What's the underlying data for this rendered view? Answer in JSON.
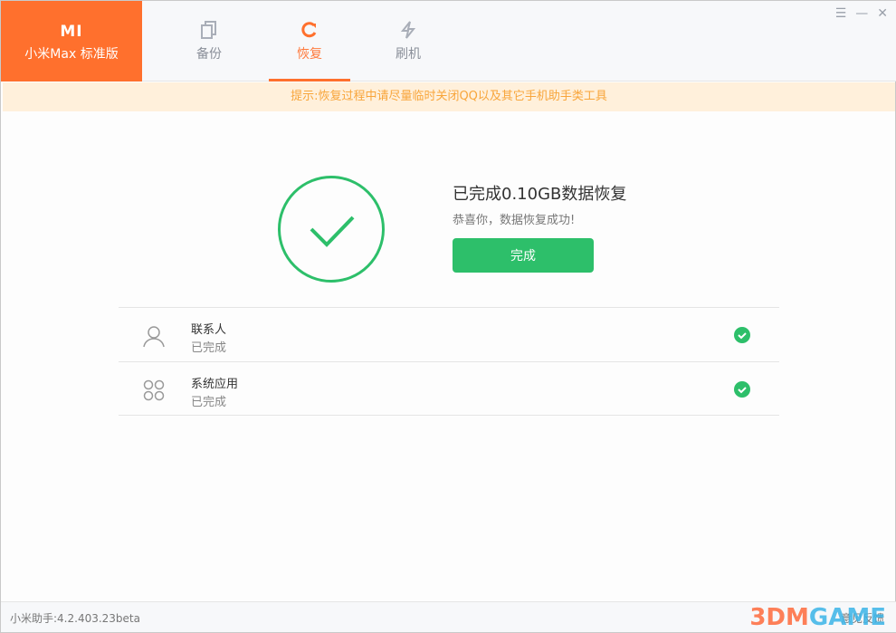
{
  "brand": {
    "logo": "MI",
    "model": "小米Max 标准版"
  },
  "tabs": [
    {
      "label": "备份",
      "icon": "copy-icon"
    },
    {
      "label": "恢复",
      "icon": "restore-icon"
    },
    {
      "label": "刷机",
      "icon": "flash-icon"
    }
  ],
  "notice": "提示:恢复过程中请尽量临时关闭QQ以及其它手机助手类工具",
  "result": {
    "title": "已完成0.10GB数据恢复",
    "subtitle": "恭喜你，数据恢复成功!",
    "button": "完成"
  },
  "items": [
    {
      "name": "联系人",
      "status": "已完成"
    },
    {
      "name": "系统应用",
      "status": "已完成"
    }
  ],
  "footer": {
    "version": "小米助手:4.2.403.23beta",
    "feedback": "意见反馈"
  },
  "watermark": {
    "a": "3DM",
    "b": "GAME"
  },
  "colors": {
    "brand": "#ff702d",
    "success": "#2dbf6a"
  }
}
